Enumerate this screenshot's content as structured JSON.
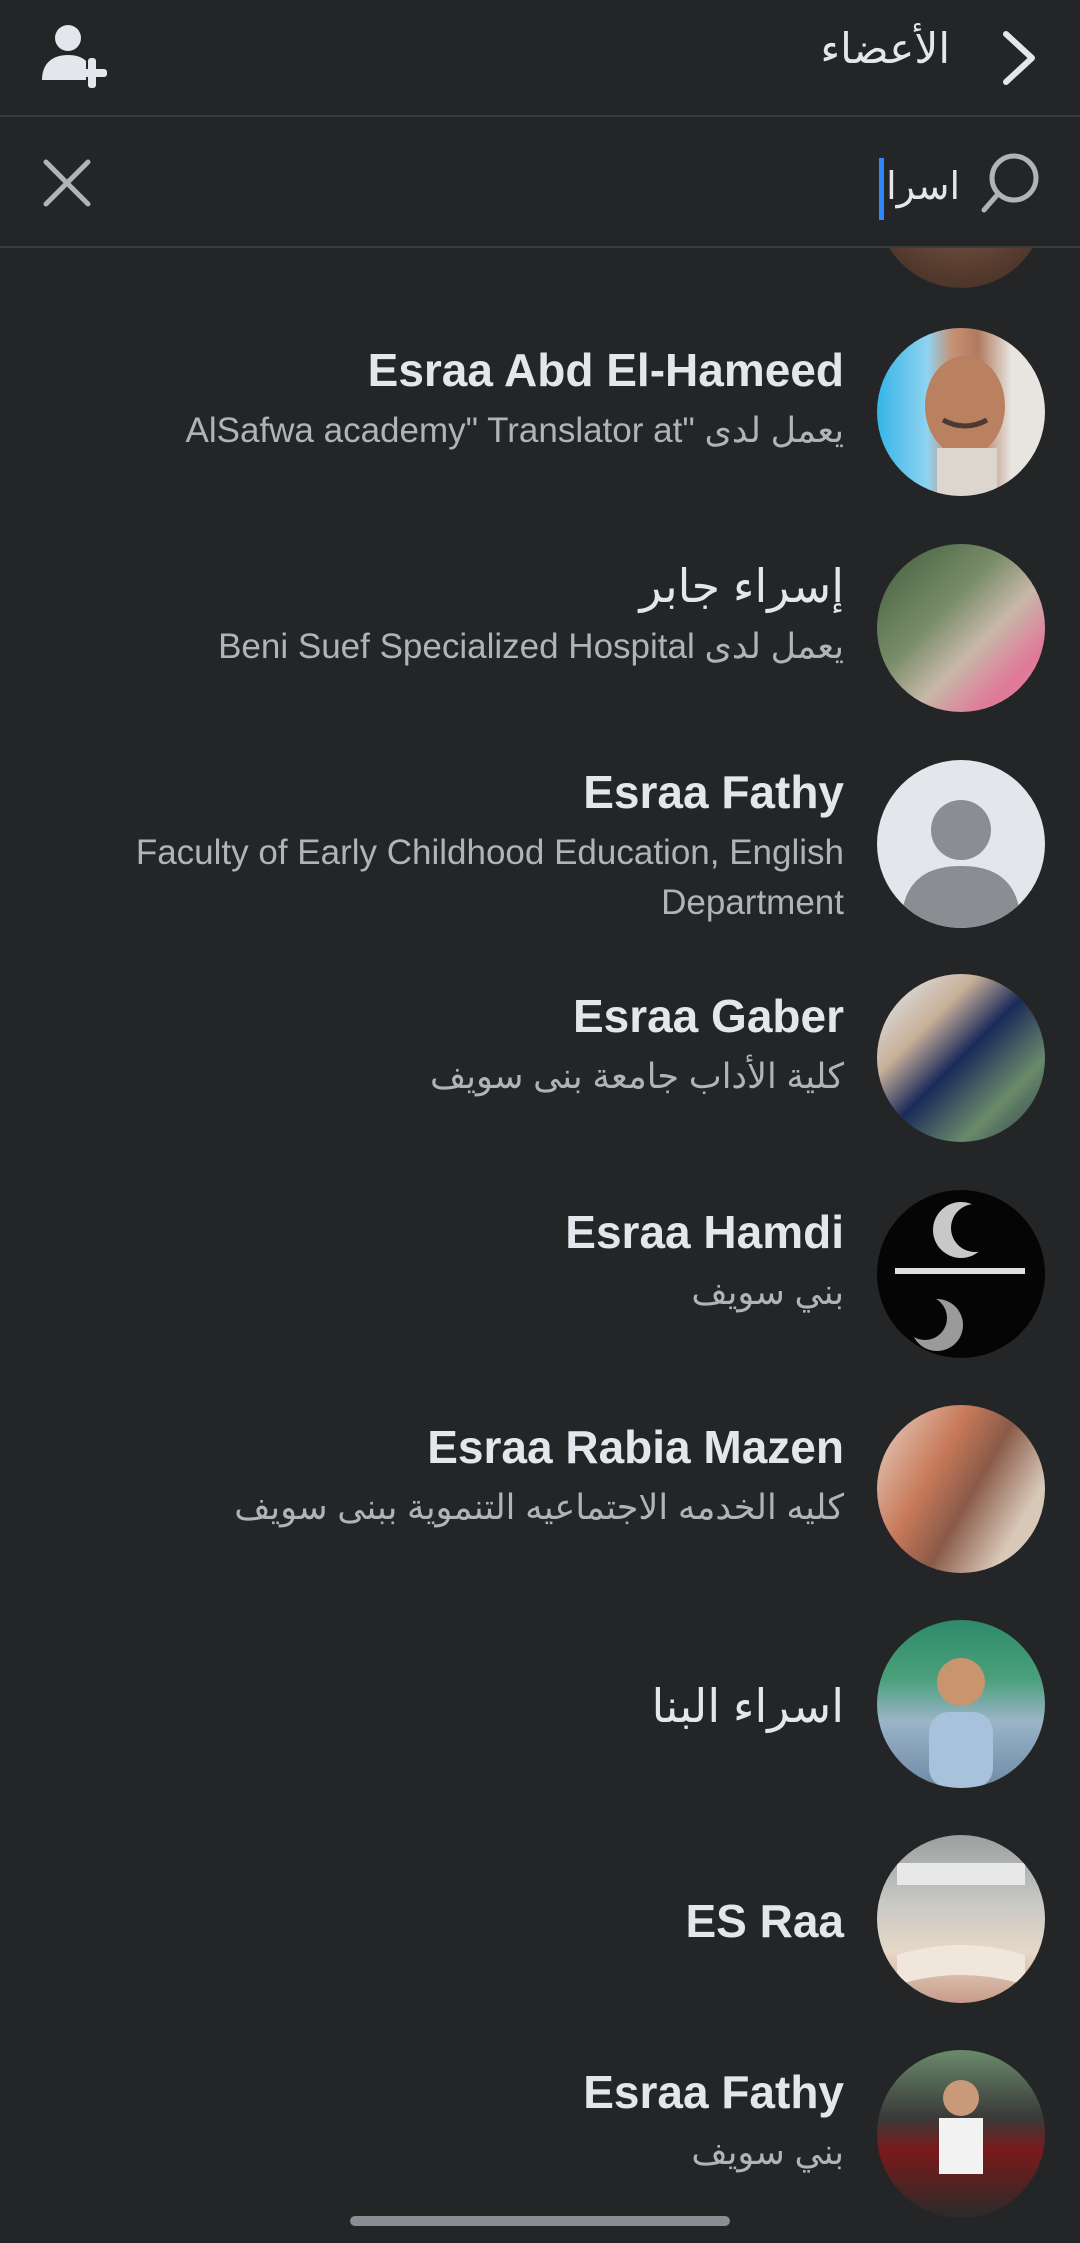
{
  "header": {
    "title": "الأعضاء",
    "back_icon": "chevron-right-icon",
    "add_member_icon": "add-user-icon"
  },
  "search": {
    "query": "اسرا",
    "search_icon": "search-icon",
    "clear_icon": "close-icon",
    "caret_color": "#2d88ff"
  },
  "members": [
    {
      "name": "Esraa Abd El-Hameed",
      "subtitle": "يعمل لدى \"AlSafwa academy\" Translator at"
    },
    {
      "name": "إسراء جابر",
      "subtitle": "يعمل لدى Beni Suef Specialized Hospital"
    },
    {
      "name": "Esraa Fathy",
      "subtitle": "Faculty of Early Childhood Education, English Department"
    },
    {
      "name": "Esraa Gaber",
      "subtitle": "كلية الأداب جامعة بنى سويف"
    },
    {
      "name": "Esraa Hamdi",
      "subtitle": "بني سويف"
    },
    {
      "name": "Esraa Rabia Mazen",
      "subtitle": "كليه الخدمه الاجتماعيه التنموية ببنى سويف"
    },
    {
      "name": "اسراء البنا",
      "subtitle": ""
    },
    {
      "name": "ES Raa",
      "subtitle": ""
    },
    {
      "name": "Esraa Fathy",
      "subtitle": "بني سويف"
    }
  ],
  "colors": {
    "background": "#242527",
    "primary_text": "#e4e6eb",
    "secondary_text": "#b0b3b8",
    "divider": "#3a3b3c"
  }
}
